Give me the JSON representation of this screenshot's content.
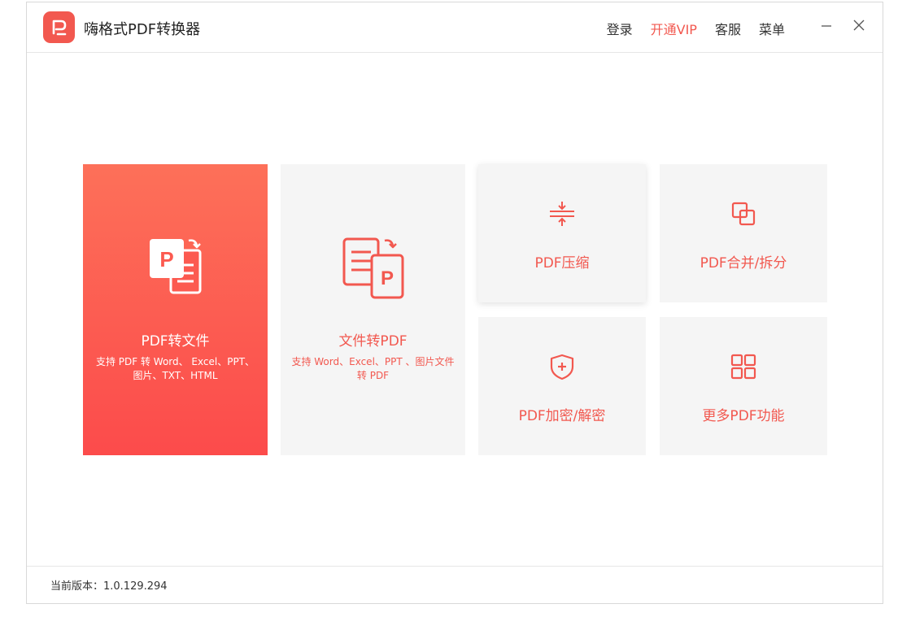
{
  "app": {
    "title": "嗨格式PDF转换器"
  },
  "nav": {
    "login": "登录",
    "vip": "开通VIP",
    "service": "客服",
    "menu": "菜单"
  },
  "cards": {
    "pdf_to_file": {
      "title": "PDF转文件",
      "desc": "支持 PDF 转 Word、 Excel、PPT、图片、TXT、HTML"
    },
    "file_to_pdf": {
      "title": "文件转PDF",
      "desc": "支持 Word、Excel、PPT 、图片文件转 PDF"
    },
    "compress": {
      "title": "PDF压缩"
    },
    "merge_split": {
      "title": "PDF合并/拆分"
    },
    "encrypt": {
      "title": "PDF加密/解密"
    },
    "more": {
      "title": "更多PDF功能"
    }
  },
  "footer": {
    "version": "当前版本：1.0.129.294"
  },
  "colors": {
    "accent": "#f2584f",
    "card_gray": "#f5f5f5"
  }
}
